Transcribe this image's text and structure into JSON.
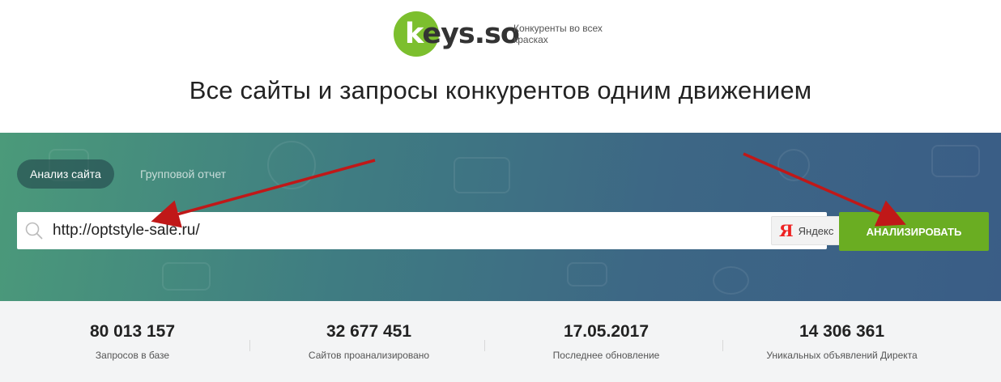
{
  "header": {
    "logo_k": "k",
    "logo_rest": "eys.so",
    "tagline": "Конкуренты во всех красках",
    "headline": "Все сайты и запросы конкурентов одним движением"
  },
  "tabs": [
    {
      "label": "Анализ сайта",
      "active": true
    },
    {
      "label": "Групповой отчет",
      "active": false
    }
  ],
  "search": {
    "value": "http://optstyle-sale.ru/",
    "engine_letter": "Я",
    "engine_label": "Яндекс"
  },
  "analyze_button": "АНАЛИЗИРОВАТЬ",
  "stats": [
    {
      "value": "80 013 157",
      "label": "Запросов в базе"
    },
    {
      "value": "32 677 451",
      "label": "Сайтов проанализировано"
    },
    {
      "value": "17.05.2017",
      "label": "Последнее обновление"
    },
    {
      "value": "14 306 361",
      "label": "Уникальных объявлений Директа"
    }
  ],
  "colors": {
    "brand_green": "#7cbf2e",
    "button_green": "#6aad22",
    "arrow_red": "#c01818",
    "banner_start": "#4b9a7a",
    "banner_end": "#3a5d86"
  }
}
